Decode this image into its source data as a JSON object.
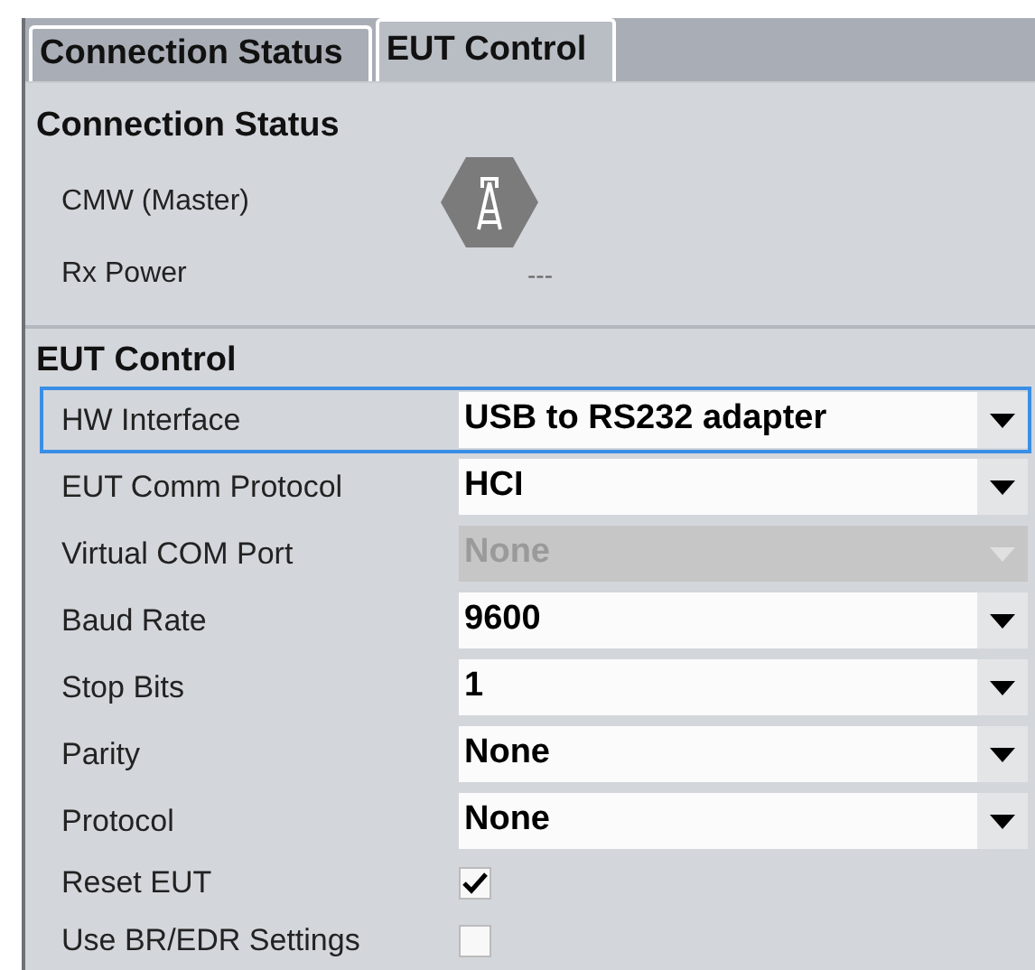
{
  "tabs": [
    {
      "label": "Connection Status",
      "selected": false
    },
    {
      "label": "EUT Control",
      "selected": true
    }
  ],
  "connection_status": {
    "title": "Connection Status",
    "rows": [
      {
        "kind": "icon",
        "label": "CMW (Master)"
      },
      {
        "kind": "text",
        "label": "Rx Power",
        "value": "---"
      }
    ]
  },
  "eut_control": {
    "title": "EUT Control",
    "rows": [
      {
        "kind": "dropdown",
        "label": "HW Interface",
        "value": "USB to RS232 adapter",
        "disabled": false,
        "selected": true
      },
      {
        "kind": "dropdown",
        "label": "EUT Comm Protocol",
        "value": "HCI",
        "disabled": false,
        "selected": false
      },
      {
        "kind": "dropdown",
        "label": "Virtual COM Port",
        "value": "None",
        "disabled": true,
        "selected": false
      },
      {
        "kind": "dropdown",
        "label": "Baud Rate",
        "value": "9600",
        "disabled": false,
        "selected": false
      },
      {
        "kind": "dropdown",
        "label": "Stop Bits",
        "value": "1",
        "disabled": false,
        "selected": false
      },
      {
        "kind": "dropdown",
        "label": "Parity",
        "value": "None",
        "disabled": false,
        "selected": false
      },
      {
        "kind": "dropdown",
        "label": "Protocol",
        "value": "None",
        "disabled": false,
        "selected": false
      },
      {
        "kind": "checkbox",
        "label": "Reset EUT",
        "checked": true
      },
      {
        "kind": "checkbox",
        "label": "Use BR/EDR Settings",
        "checked": false
      }
    ]
  }
}
